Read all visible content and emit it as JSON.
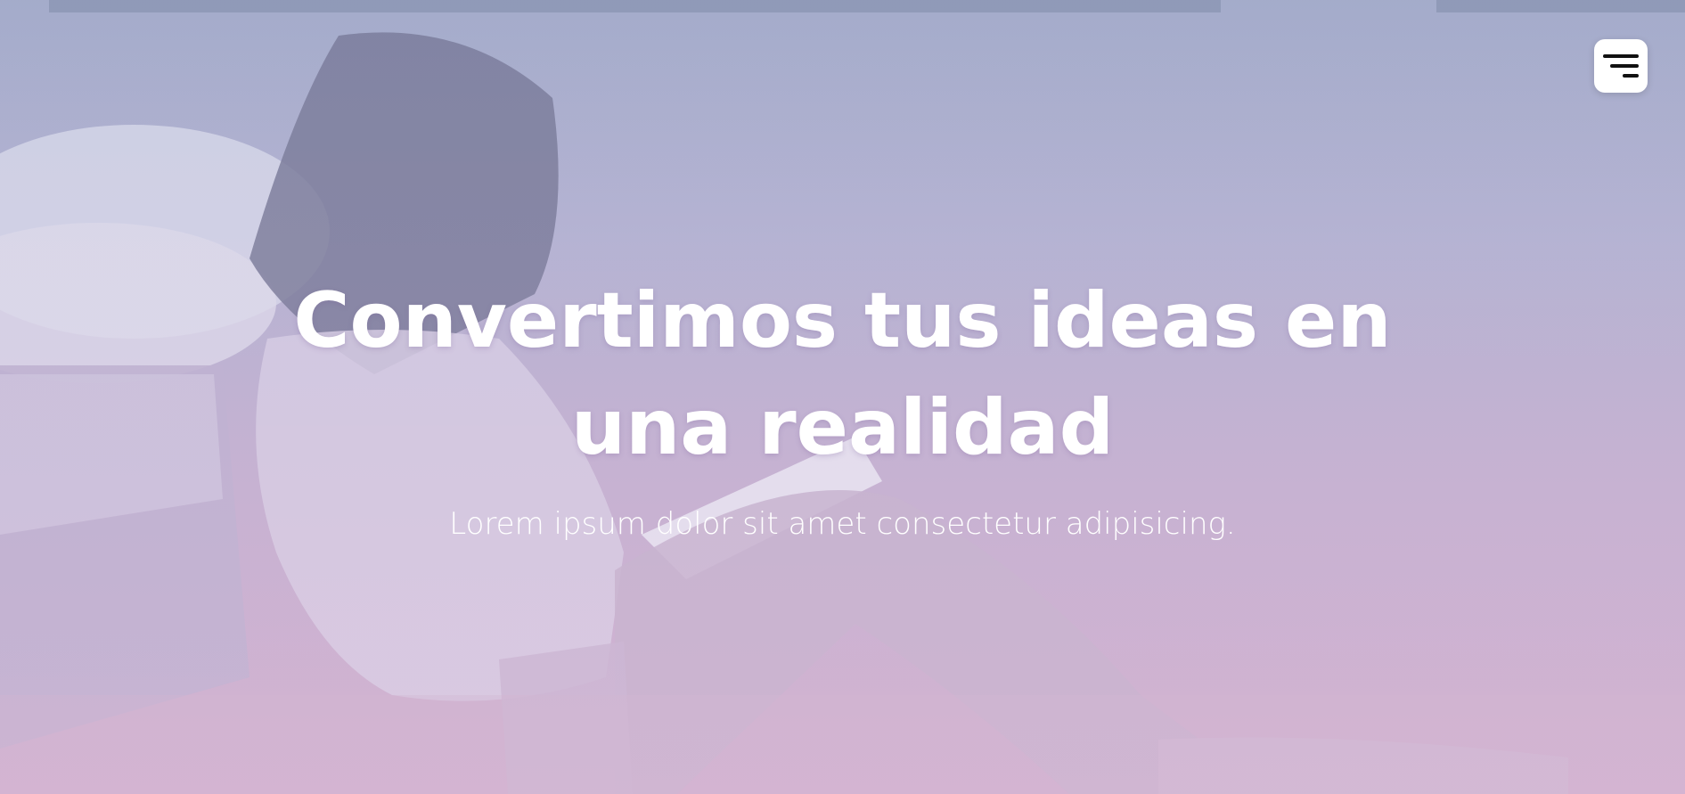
{
  "hero": {
    "title": "Convertimos tus ideas en una realidad",
    "subtitle": "Lorem ipsum dolor sit amet consectetur adipisicing."
  },
  "menu": {
    "icon": "hamburger-menu-icon"
  },
  "colors": {
    "overlay_top": "#a7aecb",
    "overlay_bottom": "#d3b3cf",
    "text": "#ffffff",
    "menu_bg": "#ffffff",
    "menu_icon": "#111111"
  }
}
